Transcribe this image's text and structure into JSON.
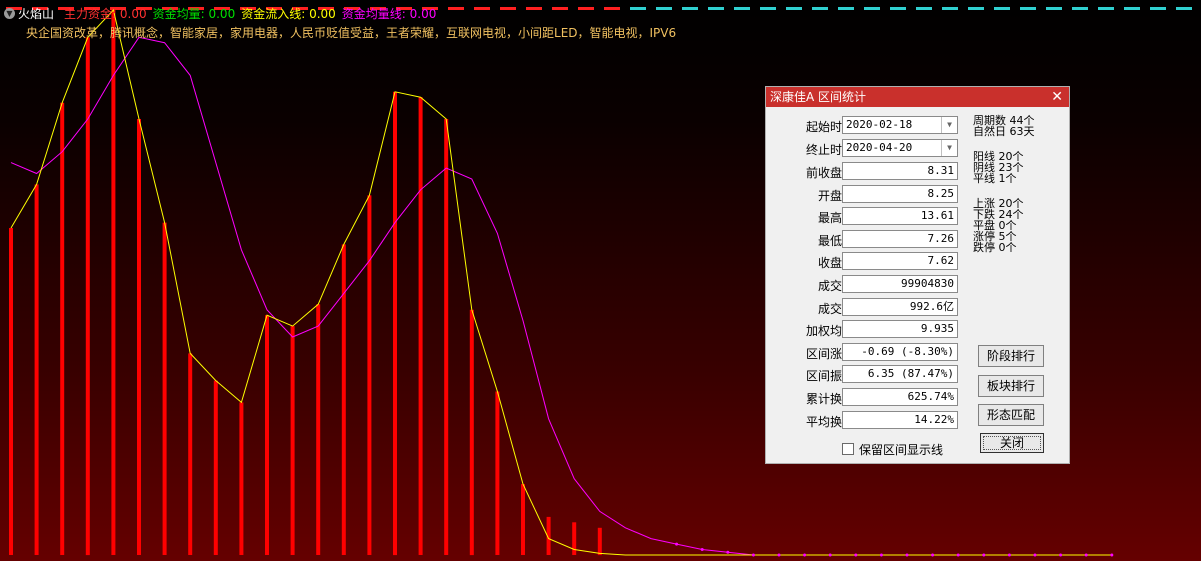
{
  "header": {
    "indicator": "火焰山",
    "metrics": [
      {
        "label": "主力资金:",
        "value": "0.00",
        "color": "#ff3030"
      },
      {
        "label": "资金均量:",
        "value": "0.00",
        "color": "#00e000"
      },
      {
        "label": "资金流入线:",
        "value": "0.00",
        "color": "#ffff00"
      },
      {
        "label": "资金均量线:",
        "value": "0.00",
        "color": "#ff00ff"
      }
    ],
    "concepts": "央企国资改革，腾讯概念，智能家居，家用电器，人民币贬值受益，王者荣耀，互联网电视，小间距LED，智能电视，IPV6"
  },
  "chart_data": {
    "type": "bar",
    "title": "",
    "bars": [
      60,
      68,
      83,
      95,
      100,
      80,
      61,
      37,
      32,
      28,
      44,
      42,
      46,
      57,
      66,
      85,
      84,
      80,
      45,
      30,
      13,
      7,
      6,
      5,
      0,
      0,
      0
    ],
    "inflow_line": [
      60,
      68,
      83,
      95,
      100,
      80,
      61,
      37,
      32,
      28,
      44,
      42,
      46,
      57,
      66,
      85,
      84,
      80,
      45,
      30,
      13,
      3,
      1,
      0.3,
      0,
      0,
      0,
      0,
      0,
      0,
      0,
      0,
      0,
      0,
      0,
      0,
      0,
      0,
      0,
      0,
      0,
      0,
      0,
      0
    ],
    "avg_line": [
      72,
      70,
      74,
      80,
      88,
      95,
      94,
      88,
      72,
      56,
      45,
      40,
      42,
      48,
      54,
      61,
      67,
      71,
      69,
      59,
      43,
      25,
      14,
      8,
      5,
      3,
      2,
      1,
      0.5,
      0,
      0,
      0,
      0,
      0,
      0,
      0,
      0,
      0,
      0,
      0,
      0,
      0,
      0,
      0
    ],
    "colors": {
      "bars": "#ff0000",
      "inflow": "#ffff00",
      "avg": "#ff00ff"
    }
  },
  "dialog": {
    "title": "深康佳A  区间统计",
    "close": "✕",
    "start_label": "起始时间",
    "start_date": "2020-02-18",
    "end_label": "终止时间",
    "end_date": "2020-04-20",
    "fields": [
      {
        "label": "前收盘价",
        "value": "8.31"
      },
      {
        "label": "开盘价",
        "value": "8.25"
      },
      {
        "label": "最高价",
        "value": "13.61"
      },
      {
        "label": "最低价",
        "value": "7.26"
      },
      {
        "label": "收盘价",
        "value": "7.62"
      },
      {
        "label": "成交量",
        "value": "99904830"
      },
      {
        "label": "成交额",
        "value": "992.6亿"
      },
      {
        "label": "加权均价",
        "value": "9.935"
      },
      {
        "label": "区间涨幅",
        "value": "-0.69 (-8.30%)"
      },
      {
        "label": "区间振幅",
        "value": "6.35 (87.47%)"
      },
      {
        "label": "累计换手",
        "value": "625.74%"
      },
      {
        "label": "平均换手",
        "value": "14.22%"
      }
    ],
    "stats_a": [
      "周期数 44个",
      "自然日 63天"
    ],
    "stats_b": [
      "阳线 20个",
      "阴线 23个",
      "平线 1个"
    ],
    "stats_c": [
      "上涨 20个",
      "下跌 24个",
      "平盘 0个",
      "涨停 5个",
      "跌停 0个"
    ],
    "buttons": [
      "阶段排行",
      "板块排行",
      "形态匹配",
      "关闭"
    ],
    "checkbox_label": "保留区间显示线"
  }
}
